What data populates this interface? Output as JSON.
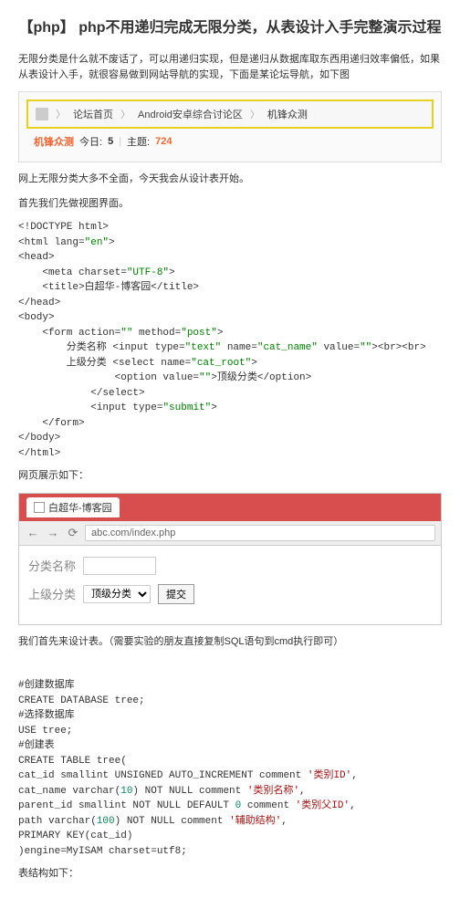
{
  "title": "【php】 php不用递归完成无限分类，从表设计入手完整演示过程",
  "intro": "无限分类是什么就不废话了，可以用递归实现，但是递归从数据库取东西用递归效率偏低，如果从表设计入手，就很容易做到网站导航的实现，下面是某论坛导航，如下图",
  "breadcrumb": {
    "home_icon": "⌂",
    "item1": "论坛首页",
    "item2": "Android安卓综合讨论区",
    "item3": "机锋众测"
  },
  "stats": {
    "name": "机锋众测",
    "label1": "今日:",
    "val1": "5",
    "label2": "主题:",
    "val2": "724"
  },
  "para2": "网上无限分类大多不全面，今天我会从设计表开始。",
  "para3": "首先我们先做视图界面。",
  "code1": {
    "l1": "<!DOCTYPE html>",
    "l2a": "<html lang=",
    "l2b": "\"en\"",
    "l2c": ">",
    "l3": "<head>",
    "l4a": "    <meta charset=",
    "l4b": "\"UTF-8\"",
    "l4c": ">",
    "l5": "    <title>白超华-博客园</title>",
    "l6": "</head>",
    "l7": "<body>",
    "l8a": "    <form action=",
    "l8b": "\"\"",
    "l8c": " method=",
    "l8d": "\"post\"",
    "l8e": ">",
    "l9a": "        分类名称 <input type=",
    "l9b": "\"text\"",
    "l9c": " name=",
    "l9d": "\"cat_name\"",
    "l9e": " value=",
    "l9f": "\"\"",
    "l9g": "><br><br>",
    "l10a": "        上级分类 <select name=",
    "l10b": "\"cat_root\"",
    "l10c": ">",
    "l11a": "                <option value=",
    "l11b": "\"\"",
    "l11c": ">顶级分类</option>",
    "l12": "            </select>",
    "l13a": "            <input type=",
    "l13b": "\"submit\"",
    "l13c": ">",
    "l14": "    </form>",
    "l15": "</body>",
    "l16": "</html>"
  },
  "para4": "网页展示如下：",
  "browser": {
    "tab_title": "白超华-博客园",
    "url": "abc.com/index.php",
    "back": "←",
    "fwd": "→",
    "reload": "⟳",
    "form_label1": "分类名称",
    "form_label2": "上级分类",
    "select_opt": "顶级分类",
    "submit": "提交"
  },
  "para5": "我们首先来设计表。（需要实验的朋友直接复制SQL语句到cmd执行即可）",
  "sql": {
    "c1": "#创建数据库",
    "s1": "CREATE DATABASE tree;",
    "c2": "#选择数据库",
    "s2": "USE tree;",
    "c3": "#创建表",
    "s3": "CREATE TABLE tree(",
    "s4a": "    cat_id smallint UNSIGNED AUTO_INCREMENT comment ",
    "s4b": "'类别ID'",
    "s4c": ",",
    "s5a": "    cat_name varchar(",
    "s5n": "10",
    "s5b": ") NOT NULL comment ",
    "s5c": "'类别名称'",
    "s5d": ",",
    "s6a": "    parent_id smallint NOT NULL DEFAULT ",
    "s6n": "0",
    "s6b": " comment ",
    "s6c": "'类别父ID'",
    "s6d": ",",
    "s7a": "    path varchar(",
    "s7n": "100",
    "s7b": ") NOT NULL comment ",
    "s7c": "'辅助结构'",
    "s7d": ",",
    "s8": "    PRIMARY KEY(cat_id)",
    "s9": ")engine=MyISAM charset=utf8;"
  },
  "para6": "表结构如下："
}
